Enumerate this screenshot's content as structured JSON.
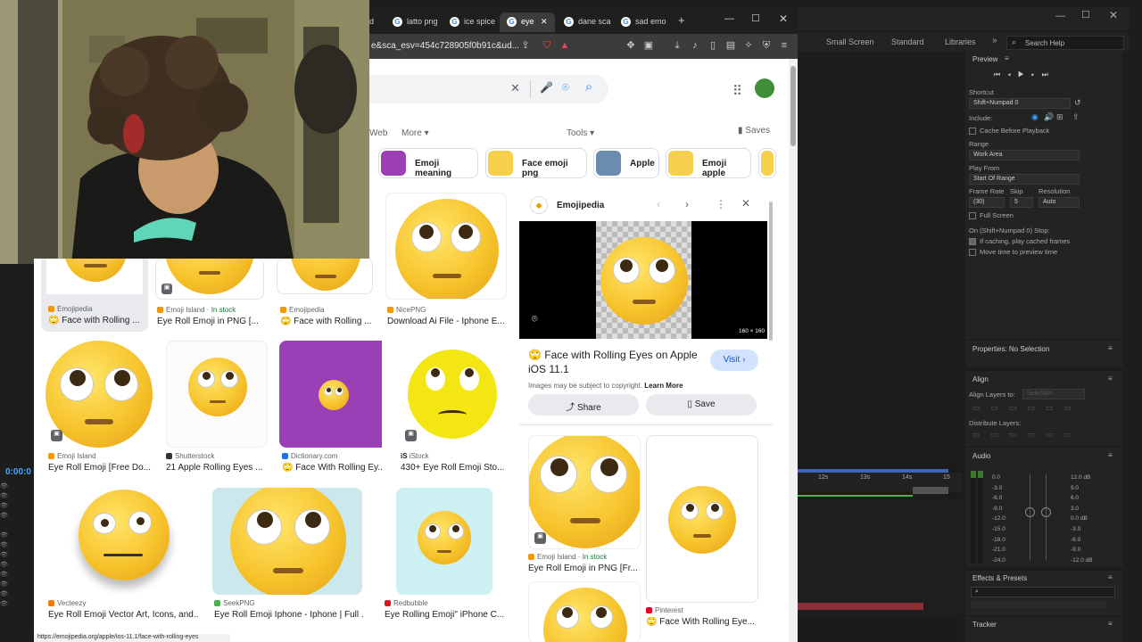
{
  "after_effects": {
    "workspace_tabs": [
      "Small Screen",
      "Standard",
      "Libraries"
    ],
    "help_search": "Search Help",
    "preview": {
      "title": "Preview",
      "shortcut_label": "Shortcut",
      "shortcut_value": "Shift+Numpad 0",
      "include_label": "Include:",
      "cache_before_playback": "Cache Before Playback",
      "range_label": "Range",
      "range_value": "Work Area",
      "play_from_label": "Play From",
      "play_from_value": "Start Of Range",
      "frame_rate_label": "Frame Rate",
      "skip_label": "Skip",
      "resolution_label": "Resolution",
      "frame_rate_value": "(30)",
      "skip_value": "5",
      "resolution_value": "Auto",
      "full_screen": "Full Screen",
      "stop_label": "On (Shift+Numpad 0) Stop:",
      "if_caching": "If caching, play cached frames",
      "move_time": "Move time to preview time"
    },
    "properties": "Properties: No Selection",
    "align": {
      "title": "Align",
      "align_layers_to": "Align Layers to:",
      "selection": "Selection",
      "distribute_layers": "Distribute Layers:"
    },
    "audio": {
      "title": "Audio",
      "left_scale": [
        "0.0",
        "-3.0",
        "-6.0",
        "-9.0",
        "-12.0",
        "-15.0",
        "-18.0",
        "-21.0",
        "-24.0"
      ],
      "right_scale": [
        "12.0 dB",
        "9.0",
        "6.0",
        "3.0",
        "0.0 dB",
        "-3.0",
        "-6.0",
        "-9.0",
        "-12.0 dB"
      ]
    },
    "effects_presets": "Effects & Presets",
    "tracker": "Tracker",
    "timeline_ticks": [
      "12s",
      "13s",
      "14s",
      "15"
    ],
    "timecode": "0:00:0"
  },
  "browser": {
    "tabs": [
      {
        "label": "d"
      },
      {
        "label": "latto png"
      },
      {
        "label": "ice spice"
      },
      {
        "label": "eye"
      },
      {
        "label": "dane sca"
      },
      {
        "label": "sad emo"
      }
    ],
    "url": "e&sca_esv=454c728905f0b91c&ud...",
    "status_url": "https://emojipedia.org/apple/ios-11.1/face-with-rolling-eyes"
  },
  "google": {
    "nav": {
      "web": "Web",
      "more": "More",
      "tools": "Tools",
      "saves": "Saves"
    },
    "chips": [
      "Emoji meaning",
      "Face emoji png",
      "Apple",
      "Emoji apple"
    ],
    "results": [
      {
        "source": "Emojipedia",
        "caption": "Face with Rolling ...",
        "stock": ""
      },
      {
        "source": "Emoji Island",
        "caption": "Eye Roll Emoji in PNG [...",
        "stock": "In stock"
      },
      {
        "source": "Emojipedia",
        "caption": "Face with Rolling ...",
        "stock": ""
      },
      {
        "source": "NicePNG",
        "caption": "Download Ai File - Iphone E...",
        "stock": ""
      },
      {
        "source": "Emoji Island",
        "caption": "Eye Roll Emoji [Free Do...",
        "stock": ""
      },
      {
        "source": "Shutterstock",
        "caption": "21 Apple Rolling Eyes ...",
        "stock": ""
      },
      {
        "source": "Dictionary.com",
        "caption": "Face With Rolling Ey...",
        "stock": ""
      },
      {
        "source": "iStock",
        "caption": "430+ Eye Roll Emoji Sto...",
        "stock": ""
      },
      {
        "source": "Vecteezy",
        "caption": "Eye Roll Emoji Vector Art, Icons, and...",
        "stock": ""
      },
      {
        "source": "SeekPNG",
        "caption": "Eye Roll Emoji Iphone - Iphone | Full ...",
        "stock": ""
      },
      {
        "source": "Redbubble",
        "caption": "Eye Rolling Emoji\" iPhone C...",
        "stock": ""
      }
    ],
    "side_panel": {
      "site": "Emojipedia",
      "image_size": "160 × 160",
      "title": "Face with Rolling Eyes on Apple iOS 11.1",
      "visit": "Visit",
      "copyright": "Images may be subject to copyright.",
      "learn_more": "Learn More",
      "share": "Share",
      "save": "Save",
      "related": [
        {
          "source": "Emoji Island",
          "stock": "In stock",
          "caption": "Eye Roll Emoji in PNG [Fr..."
        },
        {
          "source": "Pinterest",
          "stock": "",
          "caption": "Face With Rolling Eye..."
        }
      ]
    }
  },
  "colors": {
    "chrome_dark": "#1f1f1f",
    "google_blue": "#1a73e8",
    "ae_bg": "#1d1d1d",
    "emoji_yellow": "#f7c42d"
  }
}
